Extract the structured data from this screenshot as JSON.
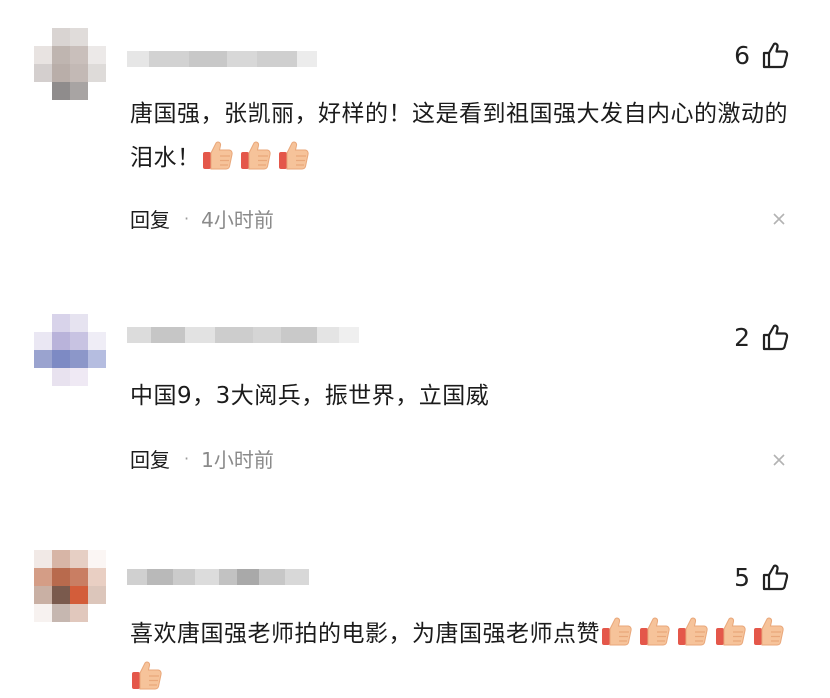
{
  "comments": [
    {
      "likes": "6",
      "text": "唐国强，张凯丽，好样的！这是看到祖国强大发自内心的激动的泪水！",
      "emoji_count": 3,
      "reply_label": "回复",
      "separator": "·",
      "time": "4小时前"
    },
    {
      "likes": "2",
      "text": "中国9，3大阅兵，振世界，立国威",
      "emoji_count": 0,
      "reply_label": "回复",
      "separator": "·",
      "time": "1小时前"
    },
    {
      "likes": "5",
      "text": "喜欢唐国强老师拍的电影，为唐国强老师点赞",
      "emoji_count": 6,
      "reply_label": "",
      "separator": "",
      "time": ""
    }
  ],
  "icons": {
    "like": "thumbs-up-outline-icon",
    "emoji": "thumbs-up-emoji-icon",
    "dismiss": "close-icon"
  },
  "colors": {
    "text": "#1b1b1b",
    "meta": "#8a8a8a",
    "emoji_skin": "#f6c39a",
    "emoji_cuff": "#e4574a"
  }
}
